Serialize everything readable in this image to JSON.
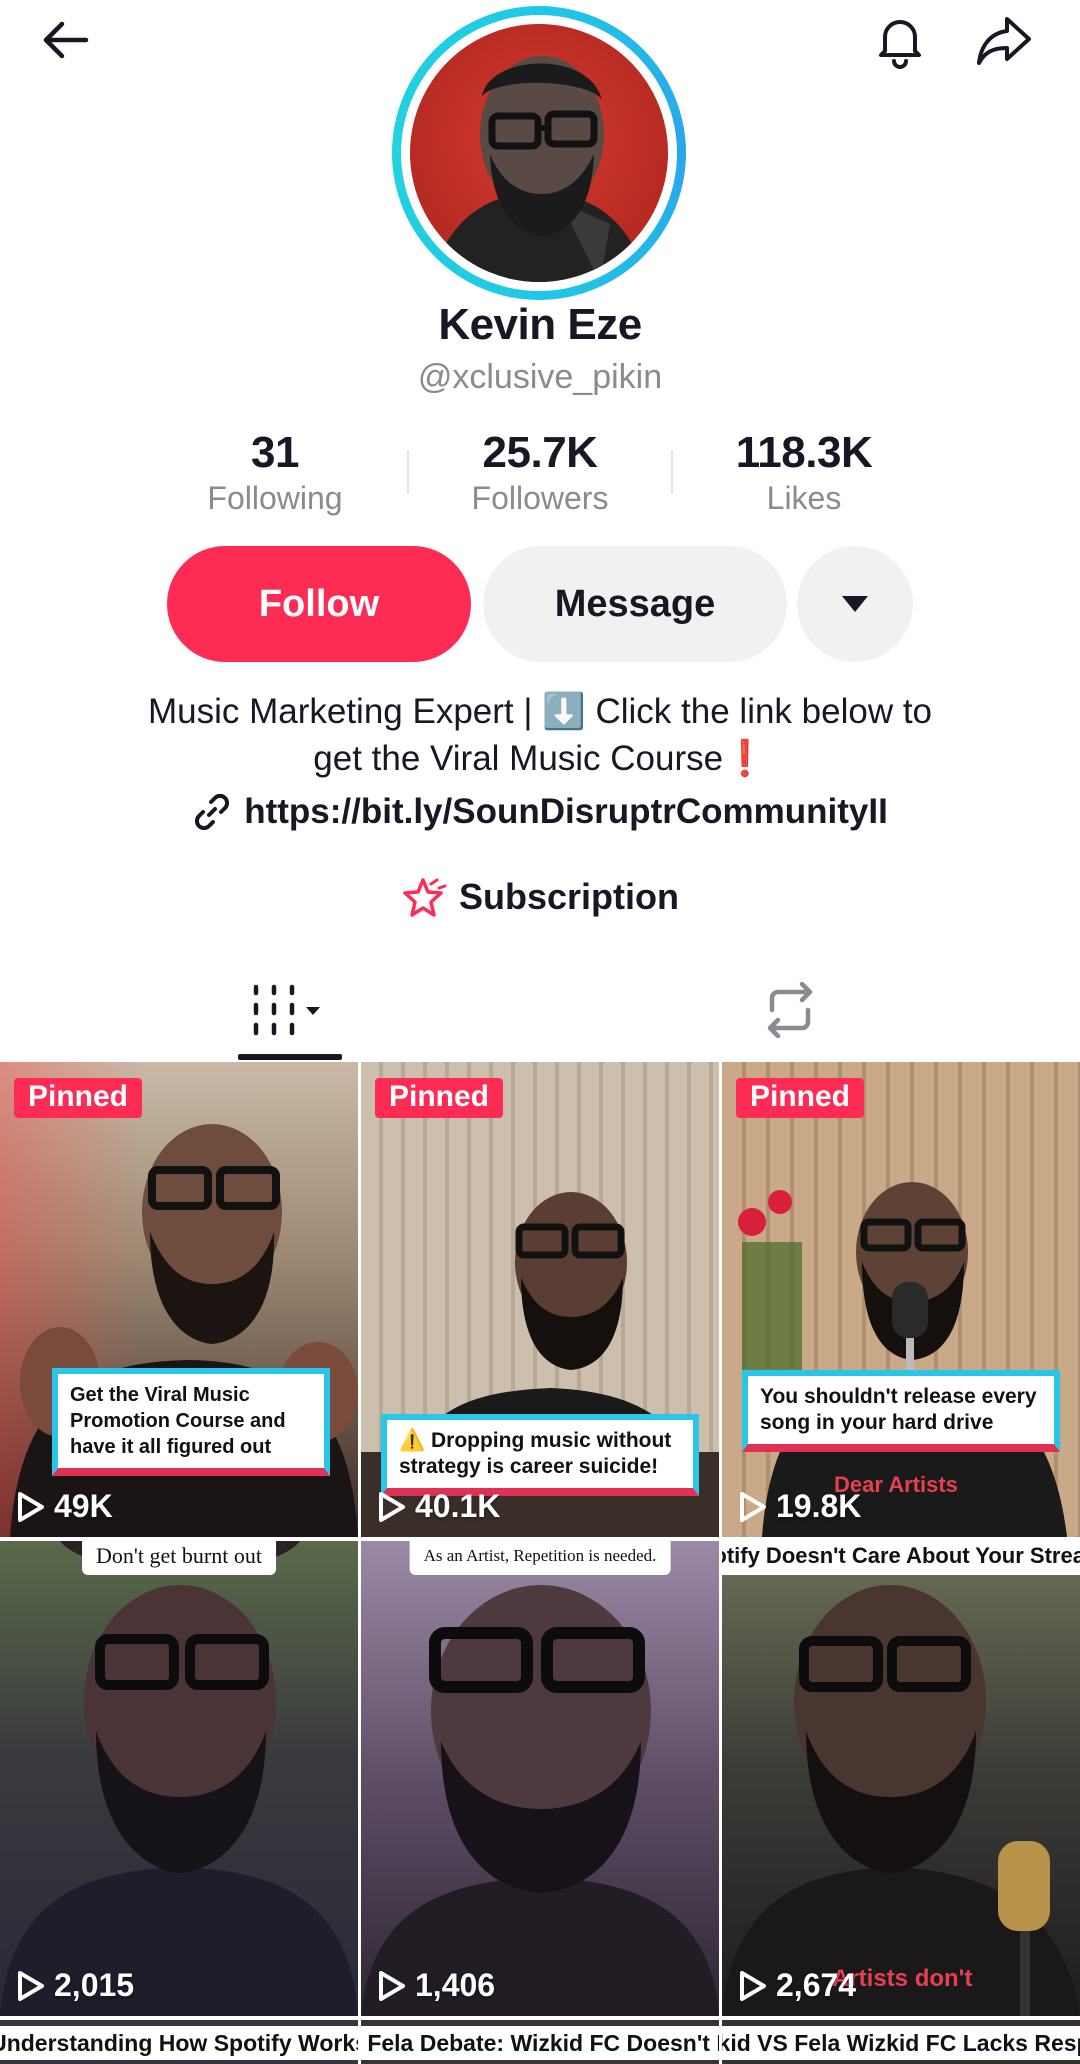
{
  "profile": {
    "name": "Kevin Eze",
    "handle": "@xclusive_pikin",
    "bio": "Music Marketing Expert | ⬇️ Click the link below to get the Viral Music Course❗",
    "bio_line1": "Music Marketing Expert | ⬇️ Click the link below to",
    "bio_line2": "get the Viral Music Course❗",
    "link": "https://bit.ly/SounDisruptrCommunityII",
    "subscription_label": "Subscription"
  },
  "stats": [
    {
      "value": "31",
      "label": "Following"
    },
    {
      "value": "25.7K",
      "label": "Followers"
    },
    {
      "value": "118.3K",
      "label": "Likes"
    }
  ],
  "actions": {
    "follow_label": "Follow",
    "message_label": "Message"
  },
  "colors": {
    "accent": "#fe2c55",
    "avatar_ring": "#1fc8e6",
    "muted_text": "#8a8b91"
  },
  "icons": [
    "back-arrow-icon",
    "bell-icon",
    "share-icon",
    "dropdown-caret-icon",
    "link-icon",
    "subscription-star-icon",
    "videos-grid-icon",
    "repost-icon",
    "play-icon"
  ],
  "videos": [
    {
      "pinned_label": "Pinned",
      "views": "49K",
      "caption": "Get the Viral Music Promotion Course and have it all figured out"
    },
    {
      "pinned_label": "Pinned",
      "views": "40.1K",
      "caption": "⚠️ Dropping music without strategy is career suicide!"
    },
    {
      "pinned_label": "Pinned",
      "views": "19.8K",
      "caption": "You shouldn't release every song in your hard drive",
      "sub_caption": "Dear Artists"
    },
    {
      "views": "2,015",
      "top_caption": "Don't get burnt out"
    },
    {
      "views": "1,406",
      "top_caption": "As an Artist, Repetition is needed."
    },
    {
      "views": "2,674",
      "top_caption": "Spotify Doesn't Care About Your Streams",
      "bottom_overlay": "Artists don't"
    },
    {
      "title": "Understanding How Spotify Works"
    },
    {
      "title": "Wizkid Vs Fela Debate: Wizkid FC Doesn't Know The"
    },
    {
      "title": "Wizkid VS Fela Wizkid FC Lacks Respect"
    }
  ]
}
